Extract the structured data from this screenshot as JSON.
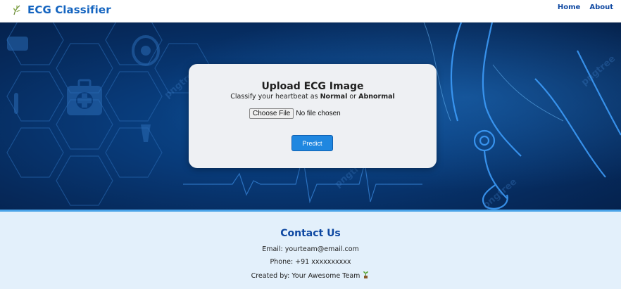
{
  "navbar": {
    "brand_icon": "leaf-icon",
    "brand_title": "ECG Classifier",
    "links": [
      {
        "label": "Home"
      },
      {
        "label": "About"
      }
    ]
  },
  "card": {
    "title": "Upload ECG Image",
    "subtitle_prefix": "Classify your heartbeat as ",
    "subtitle_normal": "Normal",
    "subtitle_or": " or ",
    "subtitle_abnormal": "Abnormal",
    "file_button": "Choose File",
    "file_status": "No file chosen",
    "predict_label": "Predict"
  },
  "footer": {
    "title": "Contact Us",
    "email": "Email: yourteam@email.com",
    "phone": "Phone: +91 xxxxxxxxxx",
    "created": "Created by: Your Awesome Team",
    "created_icon": "seedling-icon"
  },
  "colors": {
    "brand": "#1565c0",
    "nav_link": "#0d47a1",
    "hero_bg": "#083a78",
    "predict_button": "#1f87e0",
    "footer_bg": "#e3f0fb",
    "footer_title": "#0d47a1"
  }
}
